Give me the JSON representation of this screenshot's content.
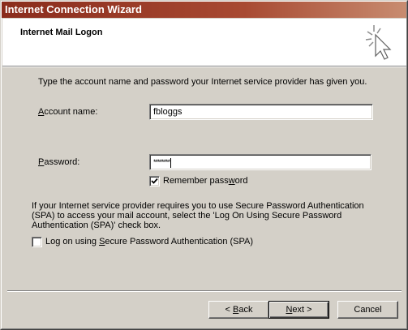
{
  "window": {
    "title": "Internet Connection Wizard"
  },
  "header": {
    "title": "Internet Mail Logon",
    "icon": "wizard-cursor-icon"
  },
  "intro": "Type the account name and password your Internet service provider has given you.",
  "account": {
    "label_prefix": "",
    "label_accel": "A",
    "label_rest": "ccount name:",
    "value": "fbloggs"
  },
  "password": {
    "label_prefix": "",
    "label_accel": "P",
    "label_rest": "assword:",
    "masked_value": "********"
  },
  "remember": {
    "checked": true,
    "label_prefix": "Remember pass",
    "label_accel": "w",
    "label_rest": "ord"
  },
  "spa_info": "If your Internet service provider requires you to use Secure Password Authentication (SPA) to access your mail account, select the 'Log On Using Secure Password Authentication (SPA)' check box.",
  "spa_checkbox": {
    "checked": false,
    "label_prefix": "Log on using ",
    "label_accel": "S",
    "label_rest": "ecure Password Authentication (SPA)"
  },
  "buttons": {
    "back": {
      "prefix": "< ",
      "accel": "B",
      "rest": "ack"
    },
    "next": {
      "prefix": "",
      "accel": "N",
      "rest": "ext >"
    },
    "cancel": {
      "label": "Cancel"
    }
  }
}
